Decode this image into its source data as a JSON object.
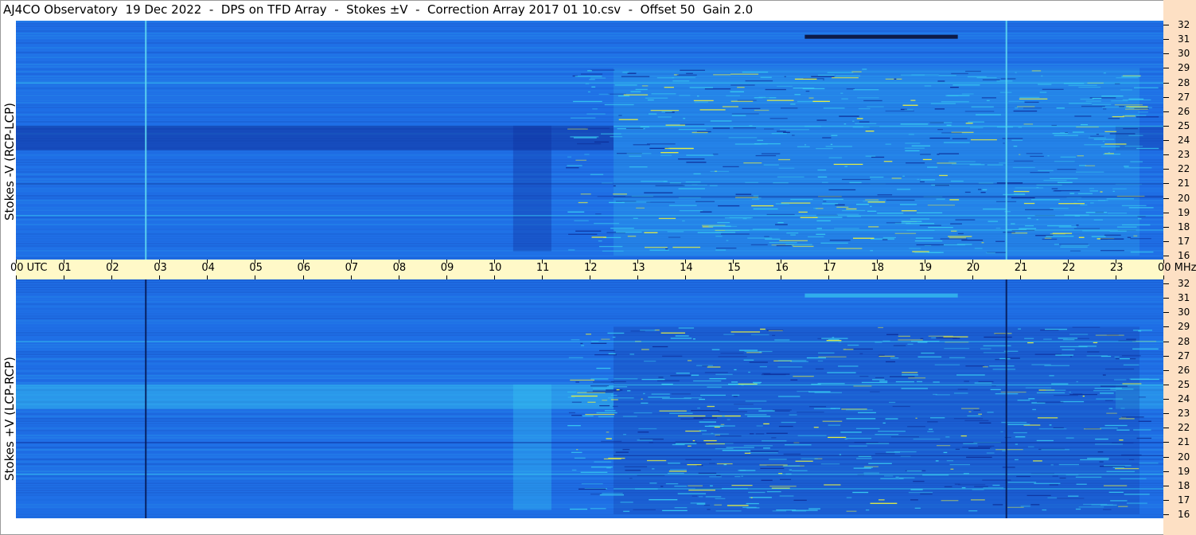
{
  "title": "AJ4CO Observatory  19 Dec 2022  -  DPS on TFD Array  -  Stokes ±V  -  Correction Array 2017 01 10.csv  -  Offset 50  Gain 2.0",
  "colors": {
    "base": "#1f6fe6",
    "dark": "#0e2f9a",
    "light": "#37c8f0",
    "yellow": "#e8f040",
    "axis_band": "#fff9c8",
    "freq_band": "#fde0c4"
  },
  "chart_data": [
    {
      "type": "heatmap",
      "title": "",
      "ylabel": "Stokes -V (RCP-LCP)",
      "x_unit": "UTC",
      "y_unit": "MHz",
      "x_ticks": [
        "00 UTC",
        "01",
        "02",
        "03",
        "04",
        "05",
        "06",
        "07",
        "08",
        "09",
        "10",
        "11",
        "12",
        "13",
        "14",
        "15",
        "16",
        "17",
        "18",
        "19",
        "20",
        "21",
        "22",
        "23",
        "00 MHz"
      ],
      "x_range": [
        0,
        24
      ],
      "y_ticks": [
        32,
        31,
        30,
        29,
        28,
        27,
        26,
        25,
        24,
        23,
        22,
        21,
        20,
        19,
        18,
        17,
        16
      ],
      "y_range": [
        16,
        32
      ],
      "features": {
        "dark_band_center_mhz": 24,
        "enhanced_period_utc": [
          12.5,
          23.5
        ],
        "vertical_line_utc": [
          2.7,
          20.7
        ],
        "vertical_line_color": "#5fd8f0"
      }
    },
    {
      "type": "heatmap",
      "title": "",
      "ylabel": "Stokes +V (LCP-RCP)",
      "x_unit": "UTC",
      "y_unit": "MHz",
      "x_range": [
        0,
        24
      ],
      "y_ticks": [
        32,
        31,
        30,
        29,
        28,
        27,
        26,
        25,
        24,
        23,
        22,
        21,
        20,
        19,
        18,
        17,
        16
      ],
      "y_range": [
        16,
        32
      ],
      "features": {
        "bright_band_center_mhz": 24,
        "enhanced_period_utc": [
          12.5,
          23.5
        ],
        "vertical_line_utc": [
          2.7,
          20.7
        ],
        "vertical_line_color": "#061a55"
      }
    }
  ]
}
